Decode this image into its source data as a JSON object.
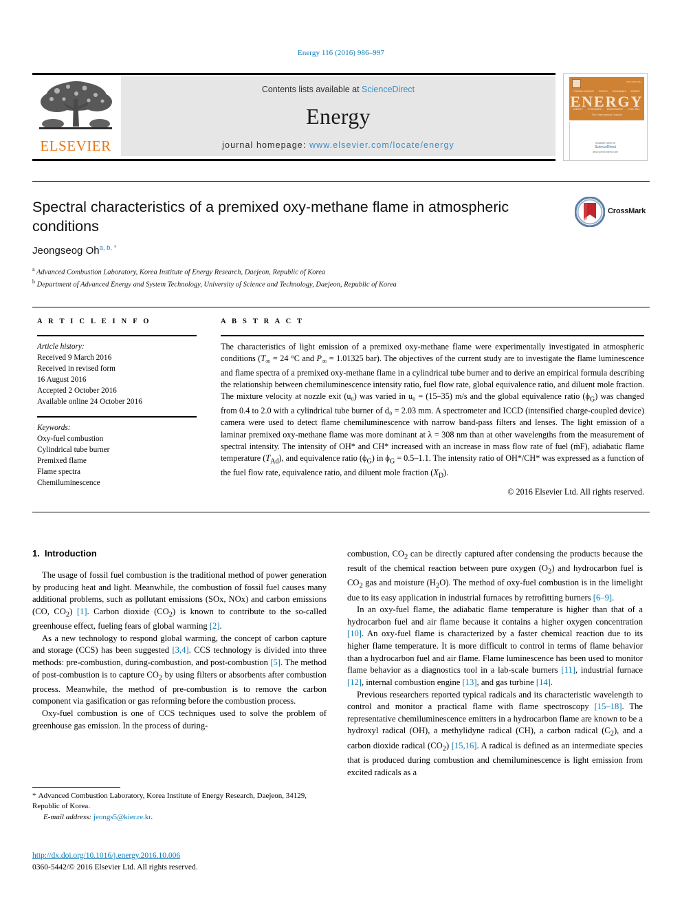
{
  "running_head": "Energy 116 (2016) 986–997",
  "masthead": {
    "contents_prefix": "Contents lists available at ",
    "sciencedirect": "ScienceDirect",
    "journal_title": "Energy",
    "homepage_label": "journal homepage: ",
    "homepage_url": "www.elsevier.com/locate/energy",
    "publisher_logo_text": "ELSEVIER",
    "publisher_logo_icon": "elsevier-tree-icon"
  },
  "cover": {
    "title": "ENERGY",
    "subtitle": "The International Journal",
    "top_labels": [
      "THERMAL SCIENCE",
      "EXERGY",
      "RENEWABLE",
      "ENERGY"
    ],
    "bottom_labels": [
      "ENERGY",
      "ECONOMICS",
      "ENVIRONMENT",
      "FUEL CELL"
    ],
    "footer_line1": "Available online at",
    "footer_brand": "ScienceDirect",
    "footer_line2": "www.sciencedirect.com"
  },
  "article": {
    "title": "Spectral characteristics of a premixed oxy-methane flame in atmospheric conditions",
    "author": "Jeongseog Oh",
    "author_marks": "a, b, *",
    "affiliation_a_mark": "a",
    "affiliation_a": "Advanced Combustion Laboratory, Korea Institute of Energy Research, Daejeon, Republic of Korea",
    "affiliation_b_mark": "b",
    "affiliation_b": "Department of Advanced Energy and System Technology, University of Science and Technology, Daejeon, Republic of Korea",
    "crossmark_label": "CrossMark",
    "crossmark_icon": "crossmark-badge-icon"
  },
  "headers": {
    "article_info": "A R T I C L E  I N F O",
    "abstract": "A B S T R A C T"
  },
  "article_info": {
    "history_label": "Article history:",
    "history": [
      "Received 9 March 2016",
      "Received in revised form",
      "16 August 2016",
      "Accepted 2 October 2016",
      "Available online 24 October 2016"
    ],
    "keywords_label": "Keywords:",
    "keywords": [
      "Oxy-fuel combustion",
      "Cylindrical tube burner",
      "Premixed flame",
      "Flame spectra",
      "Chemiluminescence"
    ]
  },
  "abstract": {
    "text": "The characteristics of light emission of a premixed oxy-methane flame were experimentally investigated in atmospheric conditions (T∞ = 24 °C and P∞ = 1.01325 bar). The objectives of the current study are to investigate the flame luminescence and flame spectra of a premixed oxy-methane flame in a cylindrical tube burner and to derive an empirical formula describing the relationship between chemiluminescence intensity ratio, fuel flow rate, global equivalence ratio, and diluent mole fraction. The mixture velocity at nozzle exit (u₀) was varied in u₀ = (15–35) m/s and the global equivalence ratio (ϕG) was changed from 0.4 to 2.0 with a cylindrical tube burner of d₀ = 2.03 mm. A spectrometer and ICCD (intensified charge-coupled device) camera were used to detect flame chemiluminescence with narrow band-pass filters and lenses. The light emission of a laminar premixed oxy-methane flame was more dominant at λ = 308 nm than at other wavelengths from the measurement of spectral intensity. The intensity of OH* and CH* increased with an increase in mass flow rate of fuel (ṁF), adiabatic flame temperature (TAd), and equivalence ratio (ϕG) in ϕG = 0.5–1.1. The intensity ratio of OH*/CH* was expressed as a function of the fuel flow rate, equivalence ratio, and diluent mole fraction (XD).",
    "copyright": "© 2016 Elsevier Ltd. All rights reserved."
  },
  "body": {
    "section_number": "1.",
    "section_title": "Introduction",
    "left_paragraphs": [
      "The usage of fossil fuel combustion is the traditional method of power generation by producing heat and light. Meanwhile, the combustion of fossil fuel causes many additional problems, such as pollutant emissions (SOx, NOx) and carbon emissions (CO, CO2) [1]. Carbon dioxide (CO2) is known to contribute to the so-called greenhouse effect, fueling fears of global warming [2].",
      "As a new technology to respond global warming, the concept of carbon capture and storage (CCS) has been suggested [3,4]. CCS technology is divided into three methods: pre-combustion, during-combustion, and post-combustion [5]. The method of post-combustion is to capture CO2 by using filters or absorbents after combustion process. Meanwhile, the method of pre-combustion is to remove the carbon component via gasification or gas reforming before the combustion process.",
      "Oxy-fuel combustion is one of CCS techniques used to solve the problem of greenhouse gas emission. In the process of during-"
    ],
    "right_paragraphs": [
      "combustion, CO2 can be directly captured after condensing the products because the result of the chemical reaction between pure oxygen (O2) and hydrocarbon fuel is CO2 gas and moisture (H2O). The method of oxy-fuel combustion is in the limelight due to its easy application in industrial furnaces by retrofitting burners [6–9].",
      "In an oxy-fuel flame, the adiabatic flame temperature is higher than that of a hydrocarbon fuel and air flame because it contains a higher oxygen concentration [10]. An oxy-fuel flame is characterized by a faster chemical reaction due to its higher flame temperature. It is more difficult to control in terms of flame behavior than a hydrocarbon fuel and air flame. Flame luminescence has been used to monitor flame behavior as a diagnostics tool in a lab-scale burners [11], industrial furnace [12], internal combustion engine [13], and gas turbine [14].",
      "Previous researchers reported typical radicals and its characteristic wavelength to control and monitor a practical flame with flame spectroscopy [15–18]. The representative chemiluminescence emitters in a hydrocarbon flame are known to be a hydroxyl radical (OH), a methylidyne radical (CH), a carbon radical (C2), and a carbon dioxide radical (CO2) [15,16]. A radical is defined as an intermediate species that is produced during combustion and chemiluminescence is light emission from excited radicals as a"
    ]
  },
  "footnotes": {
    "corresponding_mark": "*",
    "corresponding_text": "Advanced Combustion Laboratory, Korea Institute of Energy Research, Daejeon, 34129, Republic of Korea.",
    "email_label": "E-mail address:",
    "email": "jeongs5@kier.re.kr",
    "doi": "http://dx.doi.org/10.1016/j.energy.2016.10.006",
    "issn_line": "0360-5442/© 2016 Elsevier Ltd. All rights reserved."
  },
  "colors": {
    "link_blue": "#0b7ab5",
    "elsevier_orange": "#e87511",
    "cover_orange": "#cf8234",
    "banner_gray": "#e6e6e6"
  }
}
